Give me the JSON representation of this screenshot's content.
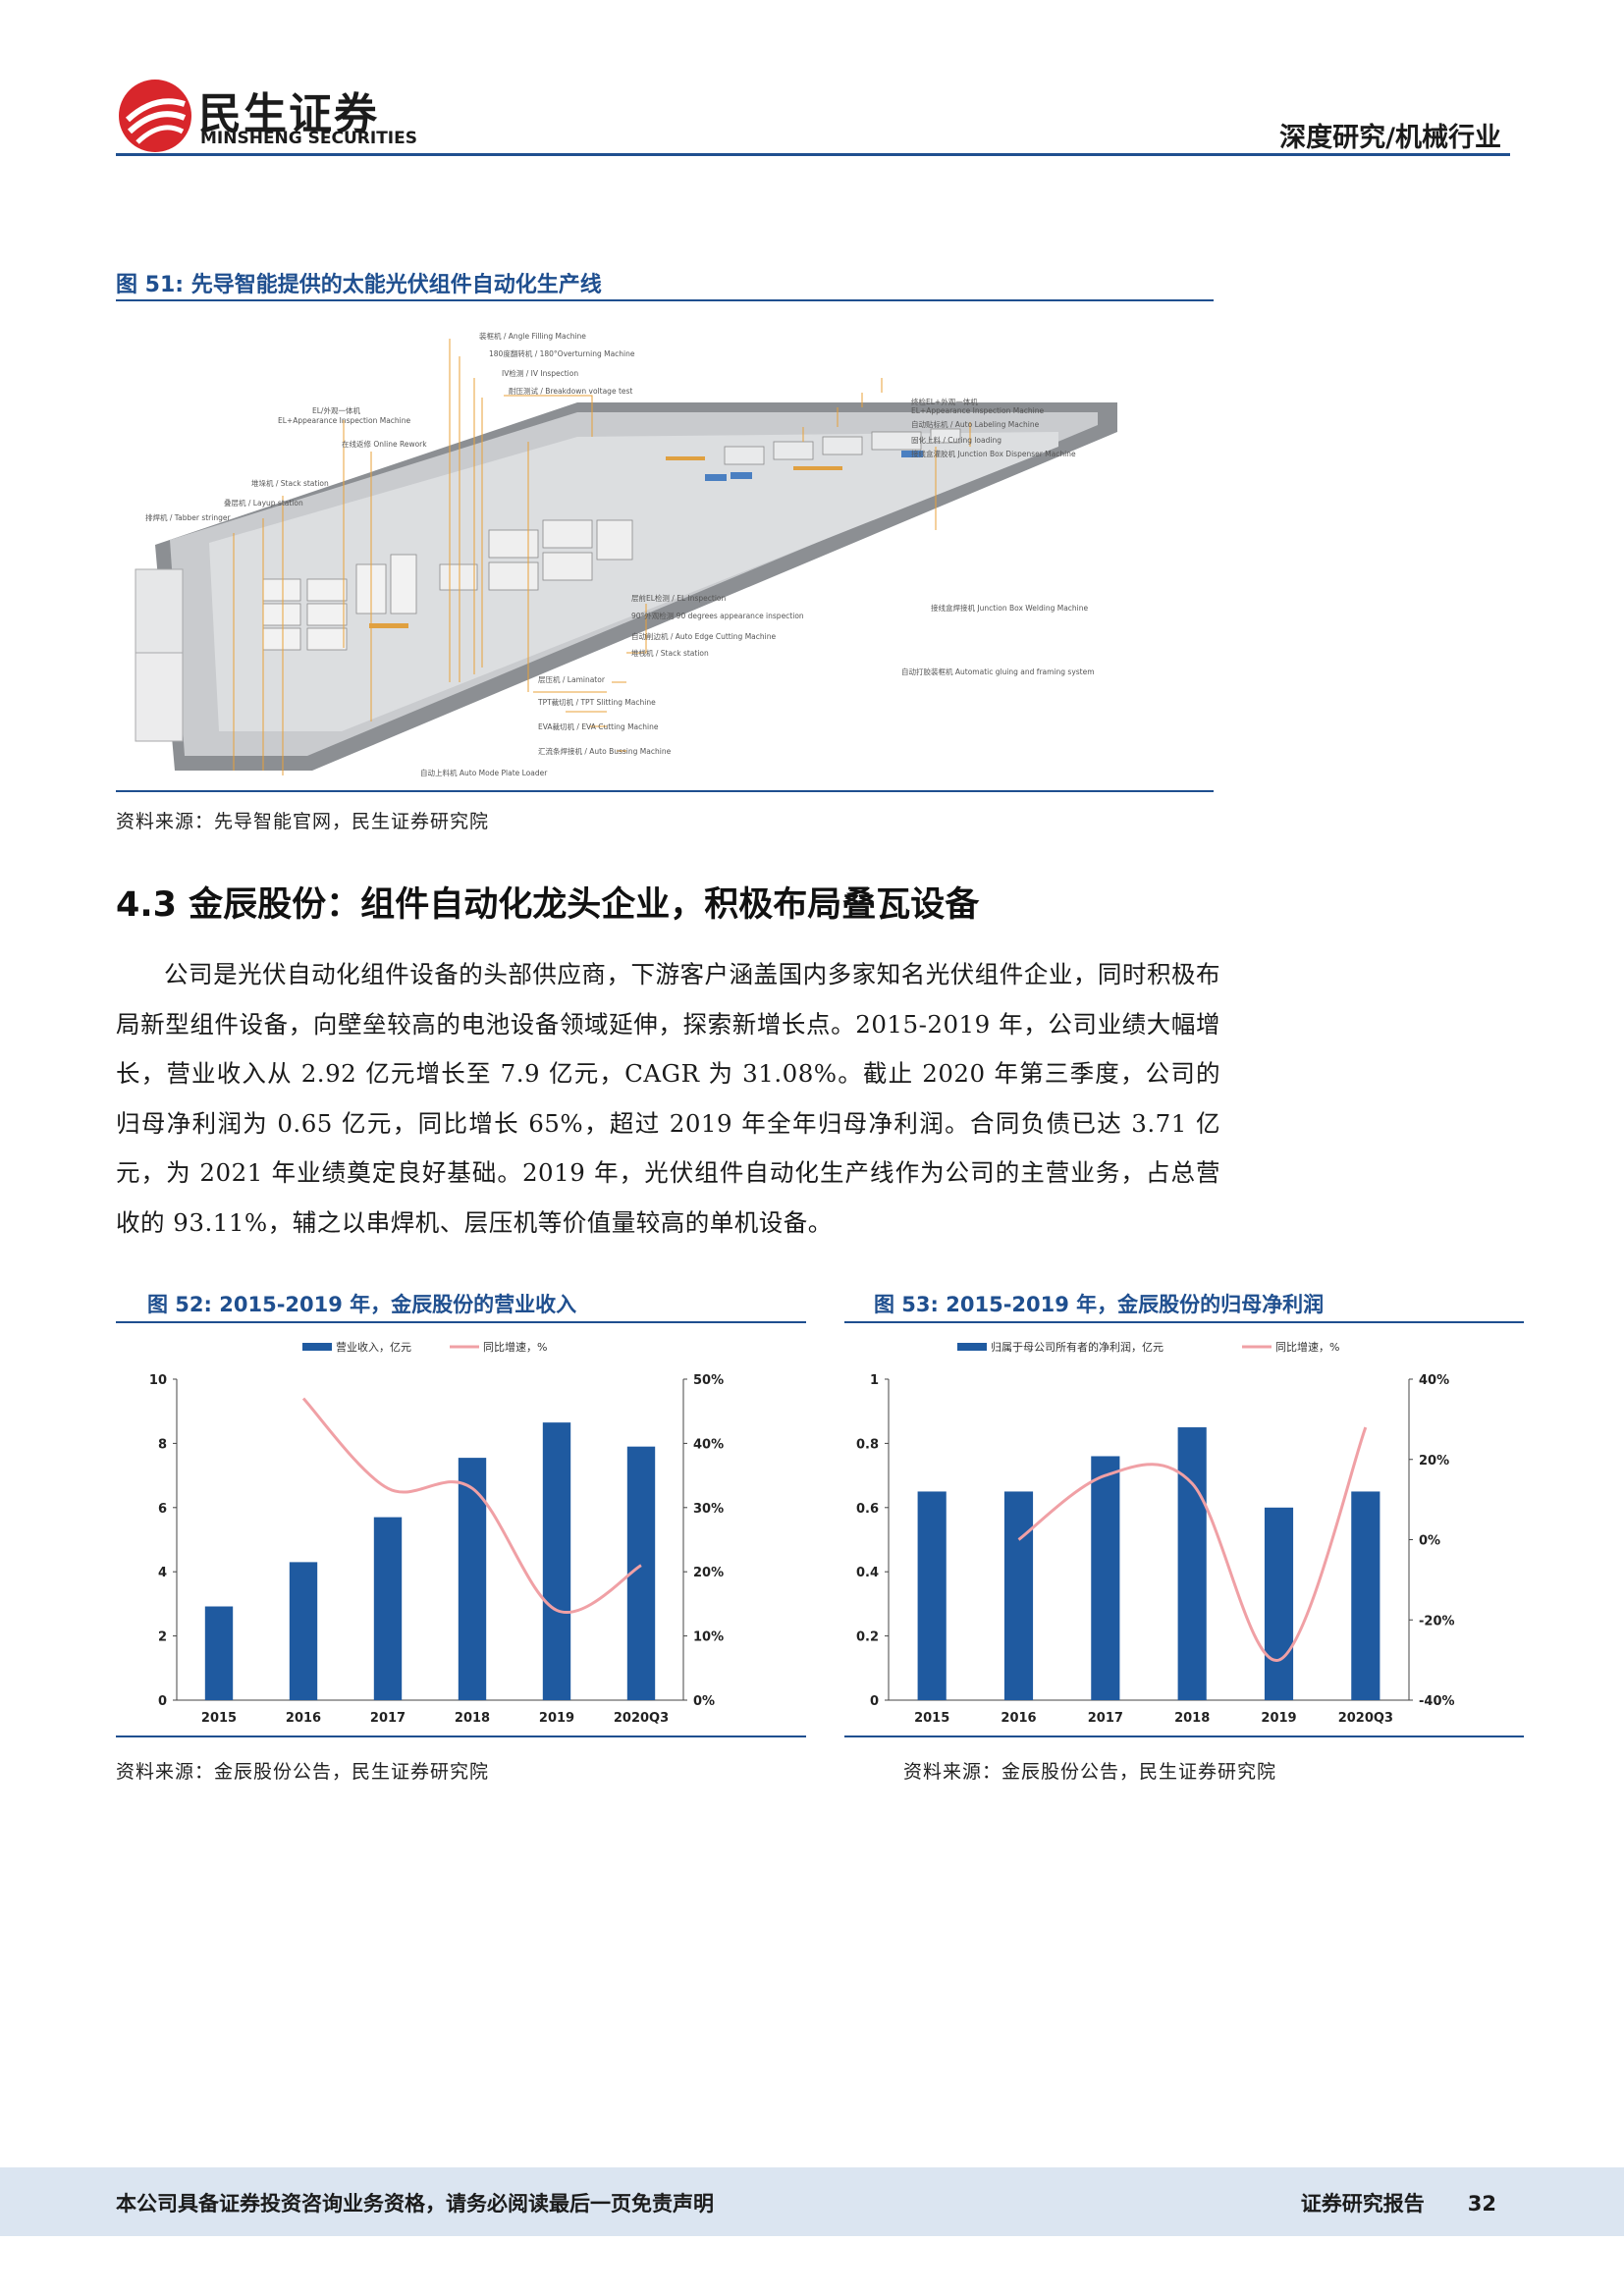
{
  "header": {
    "logo_cn": "民生证券",
    "logo_en": "MINSHENG SECURITIES",
    "right_text": "深度研究/机械行业"
  },
  "figure51": {
    "title": "图 51: 先导智能提供的太能光伏组件自动化生产线",
    "source": "资料来源：先导智能官网，民生证券研究院",
    "callouts": [
      "排焊机 / Tabber stringer",
      "叠层机 / Layup station",
      "堆垛机 / Stack station",
      "EL/外观一体机 EL+Appearance Inspection Machine",
      "在线返修 Online Rework",
      "装框机 / Angle Filling Machine",
      "180度翻转机 / 180°Overturning Machine",
      "IV检测 / IV Inspection",
      "耐压测试 / Breakdown voltage test",
      "终检EL+外观一体机 EL+Appearance Inspection Machine",
      "自动贴标机 / Auto Labeling Machine",
      "固化上料 / Curing loading",
      "接线盒灌胶机 Junction Box Dispenser Machine",
      "接线盒焊接机 Junction Box Welding Machine",
      "自动打胶装框机 Automatic gluing and framing system",
      "层前EL检测 / EL Inspection",
      "90°外观检测 90 degrees appearance inspection",
      "自动削边机 / Auto Edge Cutting Machine",
      "堆栈机 / Stack station",
      "层压机 / Laminator",
      "TPT裁切机 / TPT Slitting Machine",
      "EVA裁切机 / EVA Cutting Machine",
      "汇流条焊接机 / Auto Bussing Machine",
      "自动上料机 Auto Mode Plate Loader"
    ]
  },
  "section": {
    "title": "4.3 金辰股份：组件自动化龙头企业，积极布局叠瓦设备",
    "paragraph": "公司是光伏自动化组件设备的头部供应商，下游客户涵盖国内多家知名光伏组件企业，同时积极布局新型组件设备，向壁垒较高的电池设备领域延伸，探索新增长点。2015-2019 年，公司业绩大幅增长，营业收入从 2.92 亿元增长至 7.9 亿元，CAGR 为 31.08%。截止 2020 年第三季度，公司的归母净利润为 0.65 亿元，同比增长 65%，超过 2019 年全年归母净利润。合同负债已达 3.71 亿元，为 2021 年业绩奠定良好基础。2019 年，光伏组件自动化生产线作为公司的主营业务，占总营收的 93.11%，辅之以串焊机、层压机等价值量较高的单机设备。"
  },
  "figure52": {
    "title": "图 52: 2015-2019 年，金辰股份的营业收入",
    "source": "资料来源：金辰股份公告，民生证券研究院"
  },
  "figure53": {
    "title": "图 53: 2015-2019 年，金辰股份的归母净利润",
    "source": "资料来源：金辰股份公告，民生证券研究院"
  },
  "chart_data": [
    {
      "type": "bar",
      "categories": [
        "2015",
        "2016",
        "2017",
        "2018",
        "2019",
        "2020Q3"
      ],
      "series": [
        {
          "name": "营业收入，亿元",
          "type": "bar",
          "axis": "left",
          "values": [
            2.92,
            4.3,
            5.7,
            7.55,
            8.65,
            7.9
          ]
        },
        {
          "name": "同比增速，%",
          "type": "line",
          "axis": "right",
          "values": [
            null,
            47,
            33,
            33,
            14,
            21
          ]
        }
      ],
      "ylim": [
        0,
        10
      ],
      "yticks": [
        "0",
        "2",
        "4",
        "6",
        "8",
        "10"
      ],
      "y2lim": [
        0,
        50
      ],
      "y2ticks": [
        "0%",
        "10%",
        "20%",
        "30%",
        "40%",
        "50%"
      ],
      "colors": {
        "bar": "#1f5aa0",
        "line": "#f0a0a5"
      }
    },
    {
      "type": "bar",
      "categories": [
        "2015",
        "2016",
        "2017",
        "2018",
        "2019",
        "2020Q3"
      ],
      "series": [
        {
          "name": "归属于母公司所有者的净利润，亿元",
          "type": "bar",
          "axis": "left",
          "values": [
            0.65,
            0.65,
            0.76,
            0.85,
            0.6,
            0.65
          ]
        },
        {
          "name": "同比增速，%",
          "type": "line",
          "axis": "right",
          "values": [
            null,
            0,
            16,
            14,
            -30,
            28
          ]
        }
      ],
      "ylim": [
        0,
        1
      ],
      "yticks": [
        "0",
        "0.2",
        "0.4",
        "0.6",
        "0.8",
        "1"
      ],
      "y2lim": [
        -40,
        40
      ],
      "y2ticks": [
        "-40%",
        "-20%",
        "0%",
        "20%",
        "40%"
      ],
      "colors": {
        "bar": "#1f5aa0",
        "line": "#f0a0a5"
      }
    }
  ],
  "footer": {
    "left": "本公司具备证券投资咨询业务资格，请务必阅读最后一页免责声明",
    "right": "证券研究报告",
    "page": "32"
  }
}
